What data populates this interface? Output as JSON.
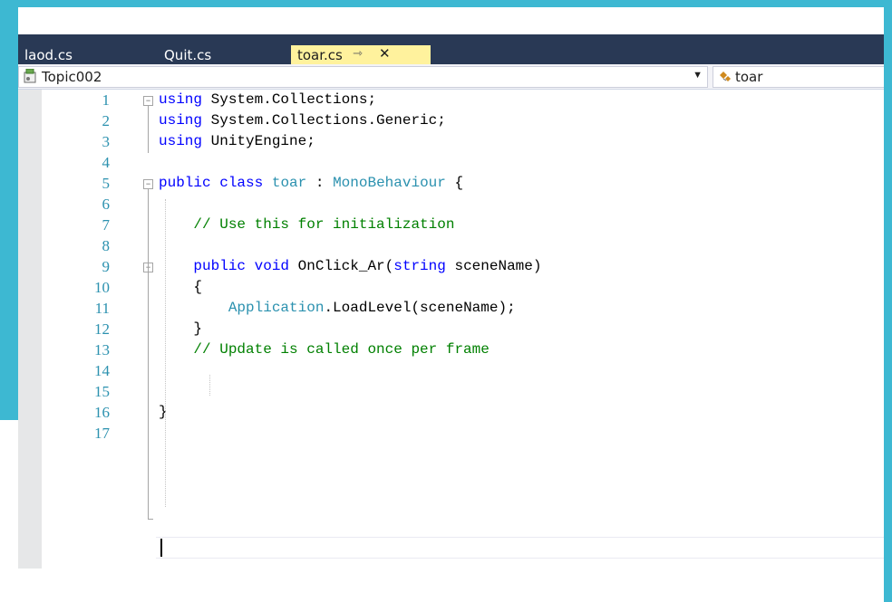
{
  "tabs": [
    {
      "label": "laod.cs"
    },
    {
      "label": "Quit.cs"
    },
    {
      "label": "toar.cs",
      "active": true
    }
  ],
  "icons": {
    "pin": "pin-icon",
    "close": "close-icon",
    "project": "project-icon",
    "class": "class-icon"
  },
  "nav": {
    "project": "Topic002",
    "member": "toar"
  },
  "colors": {
    "tab_bar": "#293955",
    "active_tab": "#fff29d",
    "keyword": "#0000ff",
    "type": "#2b91af",
    "comment": "#008000",
    "line_number": "#2b91af"
  },
  "code_lines": [
    {
      "n": "1",
      "tokens": [
        [
          "kw",
          "using"
        ],
        [
          "",
          " System.Collections;"
        ]
      ]
    },
    {
      "n": "2",
      "tokens": [
        [
          "kw",
          "using"
        ],
        [
          "",
          " System.Collections.Generic;"
        ]
      ]
    },
    {
      "n": "3",
      "tokens": [
        [
          "kw",
          "using"
        ],
        [
          "",
          " UnityEngine;"
        ]
      ]
    },
    {
      "n": "4",
      "tokens": []
    },
    {
      "n": "5",
      "tokens": [
        [
          "kw",
          "public"
        ],
        [
          "",
          " "
        ],
        [
          "kw",
          "class"
        ],
        [
          "",
          " "
        ],
        [
          "ty",
          "toar"
        ],
        [
          "",
          " : "
        ],
        [
          "ty",
          "MonoBehaviour"
        ],
        [
          "",
          " {"
        ]
      ]
    },
    {
      "n": "6",
      "tokens": []
    },
    {
      "n": "7",
      "tokens": [
        [
          "",
          "    "
        ],
        [
          "cm",
          "// Use this for initialization"
        ]
      ]
    },
    {
      "n": "8",
      "tokens": []
    },
    {
      "n": "9",
      "tokens": [
        [
          "",
          "    "
        ],
        [
          "kw",
          "public"
        ],
        [
          "",
          " "
        ],
        [
          "kw",
          "void"
        ],
        [
          "",
          " OnClick_Ar("
        ],
        [
          "kw",
          "string"
        ],
        [
          "",
          " sceneName)"
        ]
      ]
    },
    {
      "n": "10",
      "tokens": [
        [
          "",
          "    {"
        ]
      ]
    },
    {
      "n": "11",
      "tokens": [
        [
          "",
          "        "
        ],
        [
          "ty",
          "Application"
        ],
        [
          "",
          ".LoadLevel(sceneName);"
        ]
      ]
    },
    {
      "n": "12",
      "tokens": [
        [
          "",
          "    }"
        ]
      ]
    },
    {
      "n": "13",
      "tokens": [
        [
          "",
          "    "
        ],
        [
          "cm",
          "// Update is called once per frame"
        ]
      ]
    },
    {
      "n": "14",
      "tokens": []
    },
    {
      "n": "15",
      "tokens": []
    },
    {
      "n": "16",
      "tokens": [
        [
          "",
          "}"
        ]
      ]
    },
    {
      "n": "17",
      "tokens": []
    }
  ]
}
